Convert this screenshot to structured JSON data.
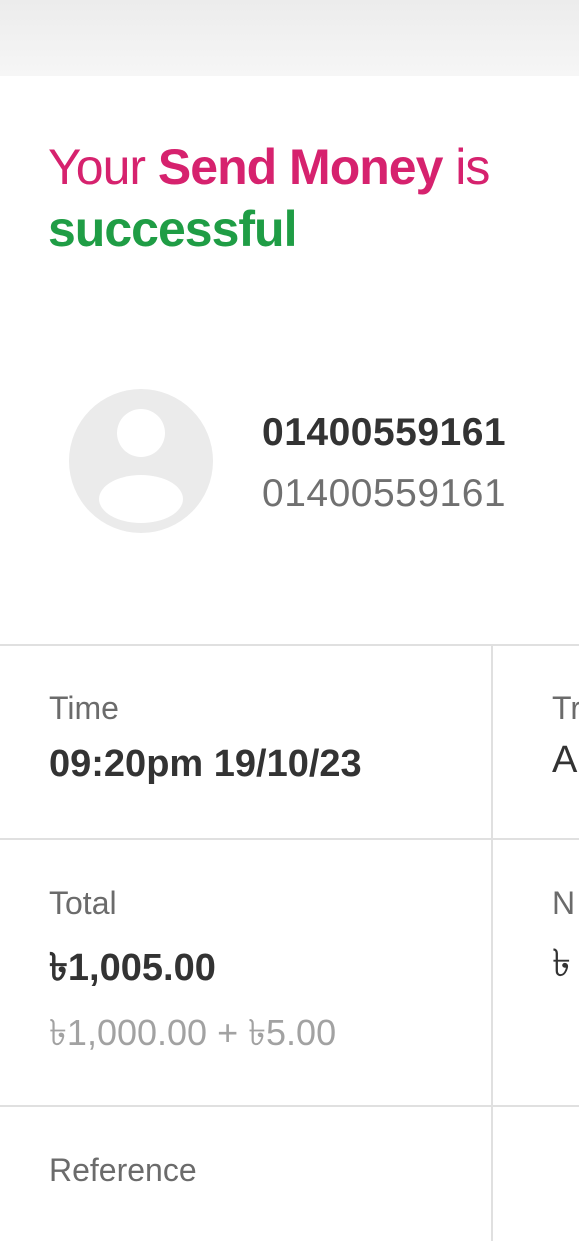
{
  "header": {
    "part1": "Your ",
    "part2": "Send Money",
    "part3": " is",
    "part4": "successful"
  },
  "recipient": {
    "name": "01400559161",
    "number": "01400559161",
    "avatar_icon": "default-user-avatar-icon"
  },
  "details": {
    "time": {
      "label": "Time",
      "value": "09:20pm 19/10/23"
    },
    "total": {
      "label": "Total",
      "value": "৳1,005.00",
      "breakdown": "৳1,000.00 + ৳5.00"
    },
    "reference": {
      "label": "Reference"
    },
    "right_column_partial": {
      "row1_label": "Tr",
      "row1_value": "A",
      "row2_label": "N",
      "row2_value": "৳"
    }
  },
  "colors": {
    "brand_pink": "#d6226e",
    "success_green": "#1f9d45"
  }
}
